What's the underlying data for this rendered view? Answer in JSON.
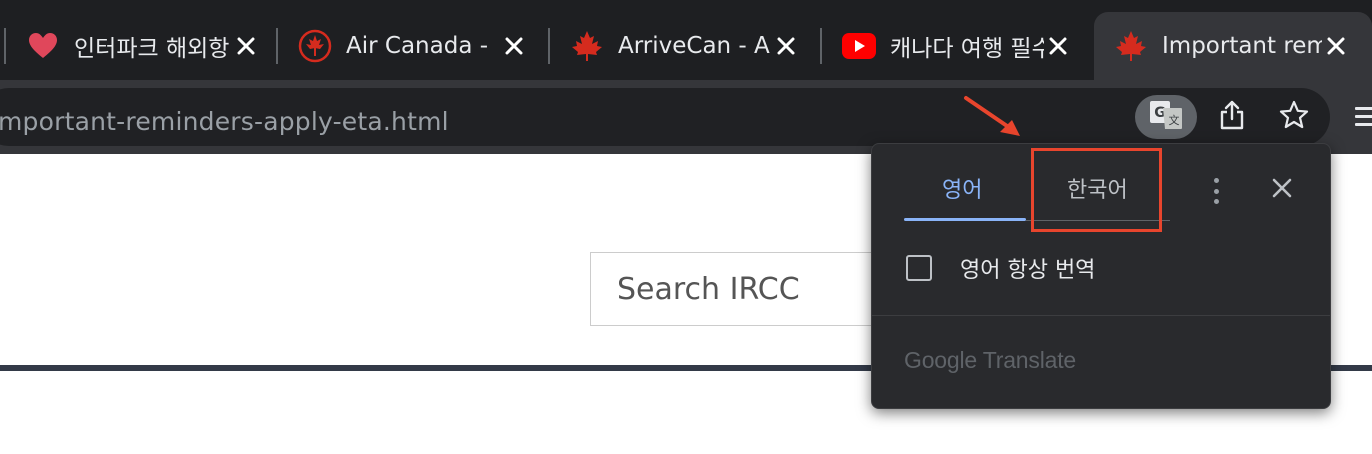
{
  "tabs": [
    {
      "title": "인터파크 해외항",
      "favicon": "heart-icon"
    },
    {
      "title": "Air Canada - ",
      "favicon": "air-canada-icon"
    },
    {
      "title": "ArriveCan - A",
      "favicon": "maple-leaf-icon"
    },
    {
      "title": "캐나다 여행 필수",
      "favicon": "youtube-icon"
    },
    {
      "title": "Important rem",
      "favicon": "maple-leaf-icon",
      "active": true
    }
  ],
  "toolbar": {
    "url": "mportant-reminders-apply-eta.html"
  },
  "page": {
    "search_placeholder": "Search IRCC"
  },
  "translate_popup": {
    "source_language": "영어",
    "target_language": "한국어",
    "always_translate_label": "영어 항상 번역",
    "footer_brand": "Google",
    "footer_product": "Translate"
  },
  "colors": {
    "tabstrip_bg": "#1e1f22",
    "toolbar_bg": "#35363a",
    "popup_bg": "#292a2d",
    "accent_blue": "#8ab4f8",
    "annotation_red": "#e8452d",
    "maple_red": "#d52b1e"
  }
}
